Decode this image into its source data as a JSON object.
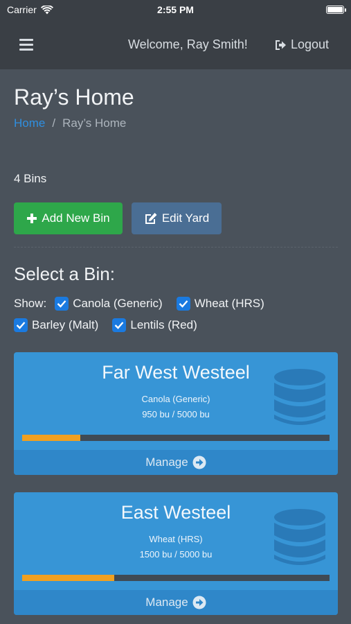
{
  "status_bar": {
    "carrier": "Carrier",
    "time": "2:55 PM"
  },
  "navbar": {
    "welcome": "Welcome, Ray Smith!",
    "logout_label": "Logout"
  },
  "page": {
    "title": "Ray’s Home",
    "breadcrumb": {
      "home": "Home",
      "separator": "/",
      "current": "Ray’s Home"
    },
    "bin_count": "4 Bins"
  },
  "actions": {
    "add_label": "Add New Bin",
    "edit_label": "Edit Yard"
  },
  "select": {
    "title": "Select a Bin:",
    "show_label": "Show:",
    "filters": [
      {
        "label": "Canola (Generic)",
        "checked": true
      },
      {
        "label": "Wheat (HRS)",
        "checked": true
      },
      {
        "label": "Barley (Malt)",
        "checked": true
      },
      {
        "label": "Lentils (Red)",
        "checked": true
      }
    ]
  },
  "bins": [
    {
      "name": "Far West Westeel",
      "crop": "Canola (Generic)",
      "amount": "950 bu / 5000 bu",
      "fill_fraction": 0.19,
      "manage_label": "Manage"
    },
    {
      "name": "East Westeel",
      "crop": "Wheat (HRS)",
      "amount": "1500 bu / 5000 bu",
      "fill_fraction": 0.3,
      "manage_label": "Manage"
    }
  ],
  "colors": {
    "accent": "#3795d6",
    "progress": "#f0a020",
    "success": "#2ea74a",
    "link": "#2f8fe0"
  },
  "icons": [
    "wifi-icon",
    "battery-icon",
    "hamburger-icon",
    "logout-icon",
    "plus-icon",
    "edit-icon",
    "checkbox-icon",
    "database-icon",
    "arrow-circle-right-icon"
  ]
}
